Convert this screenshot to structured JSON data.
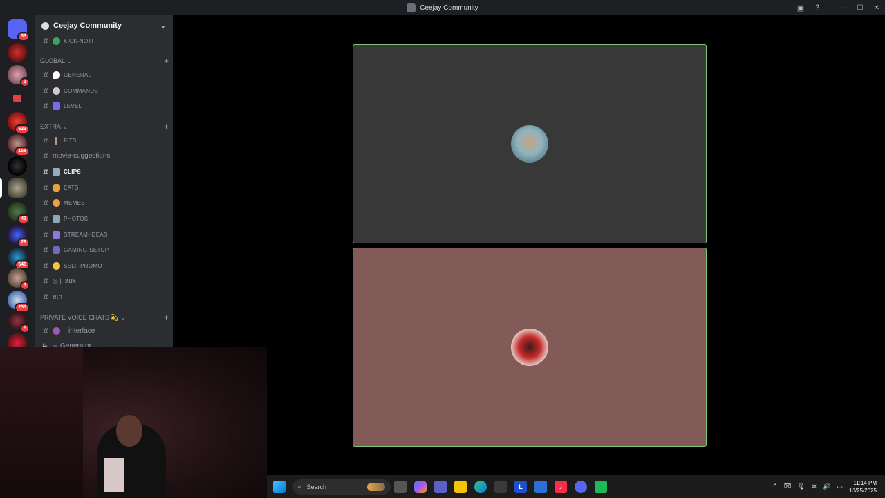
{
  "window": {
    "title": "Ceejay Community"
  },
  "server_badges": [
    "33",
    "1",
    "623",
    "168",
    "41",
    "29",
    "546",
    "1",
    "233",
    "5"
  ],
  "guild": {
    "name": "Ceejay Community"
  },
  "channels": [
    {
      "name": "KICK-NOTI"
    },
    {
      "category": "GLOBAL"
    },
    {
      "name": "GENERAL"
    },
    {
      "name": "COMMANDS"
    },
    {
      "name": "LEVEL"
    },
    {
      "category": "EXTRA"
    },
    {
      "name": "FITS"
    },
    {
      "name": "movie-suggestions"
    },
    {
      "name": "CLIPS"
    },
    {
      "name": "EATS"
    },
    {
      "name": "MEMES"
    },
    {
      "name": "PHOTOS"
    },
    {
      "name": "STREAM-IDEAS"
    },
    {
      "name": "GAMING-SETUP"
    },
    {
      "name": "SELF-PROMO"
    },
    {
      "name": "aux"
    },
    {
      "name": "eth"
    },
    {
      "category": "PRIVATE VOICE CHATS"
    },
    {
      "name": "interface"
    },
    {
      "name": "Generator"
    }
  ],
  "taskbar": {
    "search_placeholder": "Search"
  },
  "clock": {
    "time": "11:14 PM",
    "date": "10/25/2025"
  },
  "colors": {
    "tile_top": "#383838",
    "tile_bottom": "#825a58",
    "speaking_border": "#7fc77a",
    "sidebar": "#2b2d31",
    "rail": "#1e1f22"
  }
}
